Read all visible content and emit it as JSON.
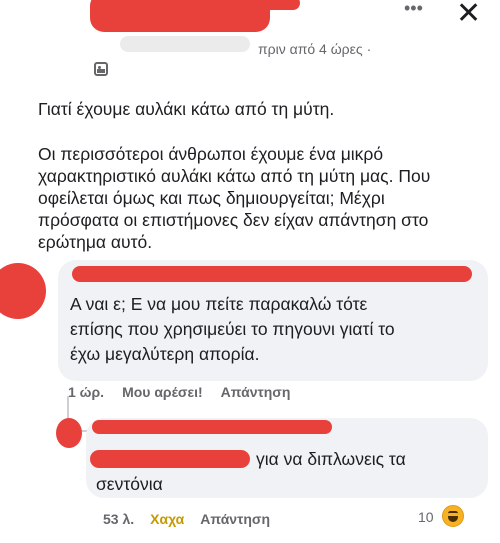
{
  "post": {
    "timestamp": "πριν από 4 ώρες",
    "meta_separator": "·",
    "title": "Γιατί έχουμε αυλάκι κάτω από τη μύτη.",
    "body": "Οι περισσότεροι άνθρωποι έχουμε ένα μικρό\nχαρακτηριστικό αυλάκι κάτω από τη μύτη μας. Που\nοφείλεται όμως και πως δημιουργείται; Μέχρι\nπρόσφατα οι επιστήμονες δεν είχαν απάντηση στο\nερώτημα αυτό.",
    "more_icon": "three-dots-icon",
    "close_icon": "close-icon",
    "audience_icon": "friends-audience-icon"
  },
  "comment": {
    "text": "Α ναι ε; Ε να μου πείτε παρακαλώ τότε\nεπίσης που χρησιμεύει το πηγουνι γιατί το\nέχω μεγαλύτερη απορία.",
    "time": "1 ώρ.",
    "like_label": "Μου αρέσει!",
    "reply_label": "Απάντηση"
  },
  "reply": {
    "text_line1": "για να διπλωνεις τα",
    "text_line2": "σεντόνια",
    "time": "53 λ.",
    "reaction_label": "Χαχα",
    "reply_label": "Απάντηση",
    "reaction_count": "10",
    "reaction_icon": "haha-emoji-icon"
  },
  "colors": {
    "redaction": "#e8413c",
    "bubble": "#f0f2f5",
    "muted": "#65676b",
    "haha": "#c59900"
  }
}
